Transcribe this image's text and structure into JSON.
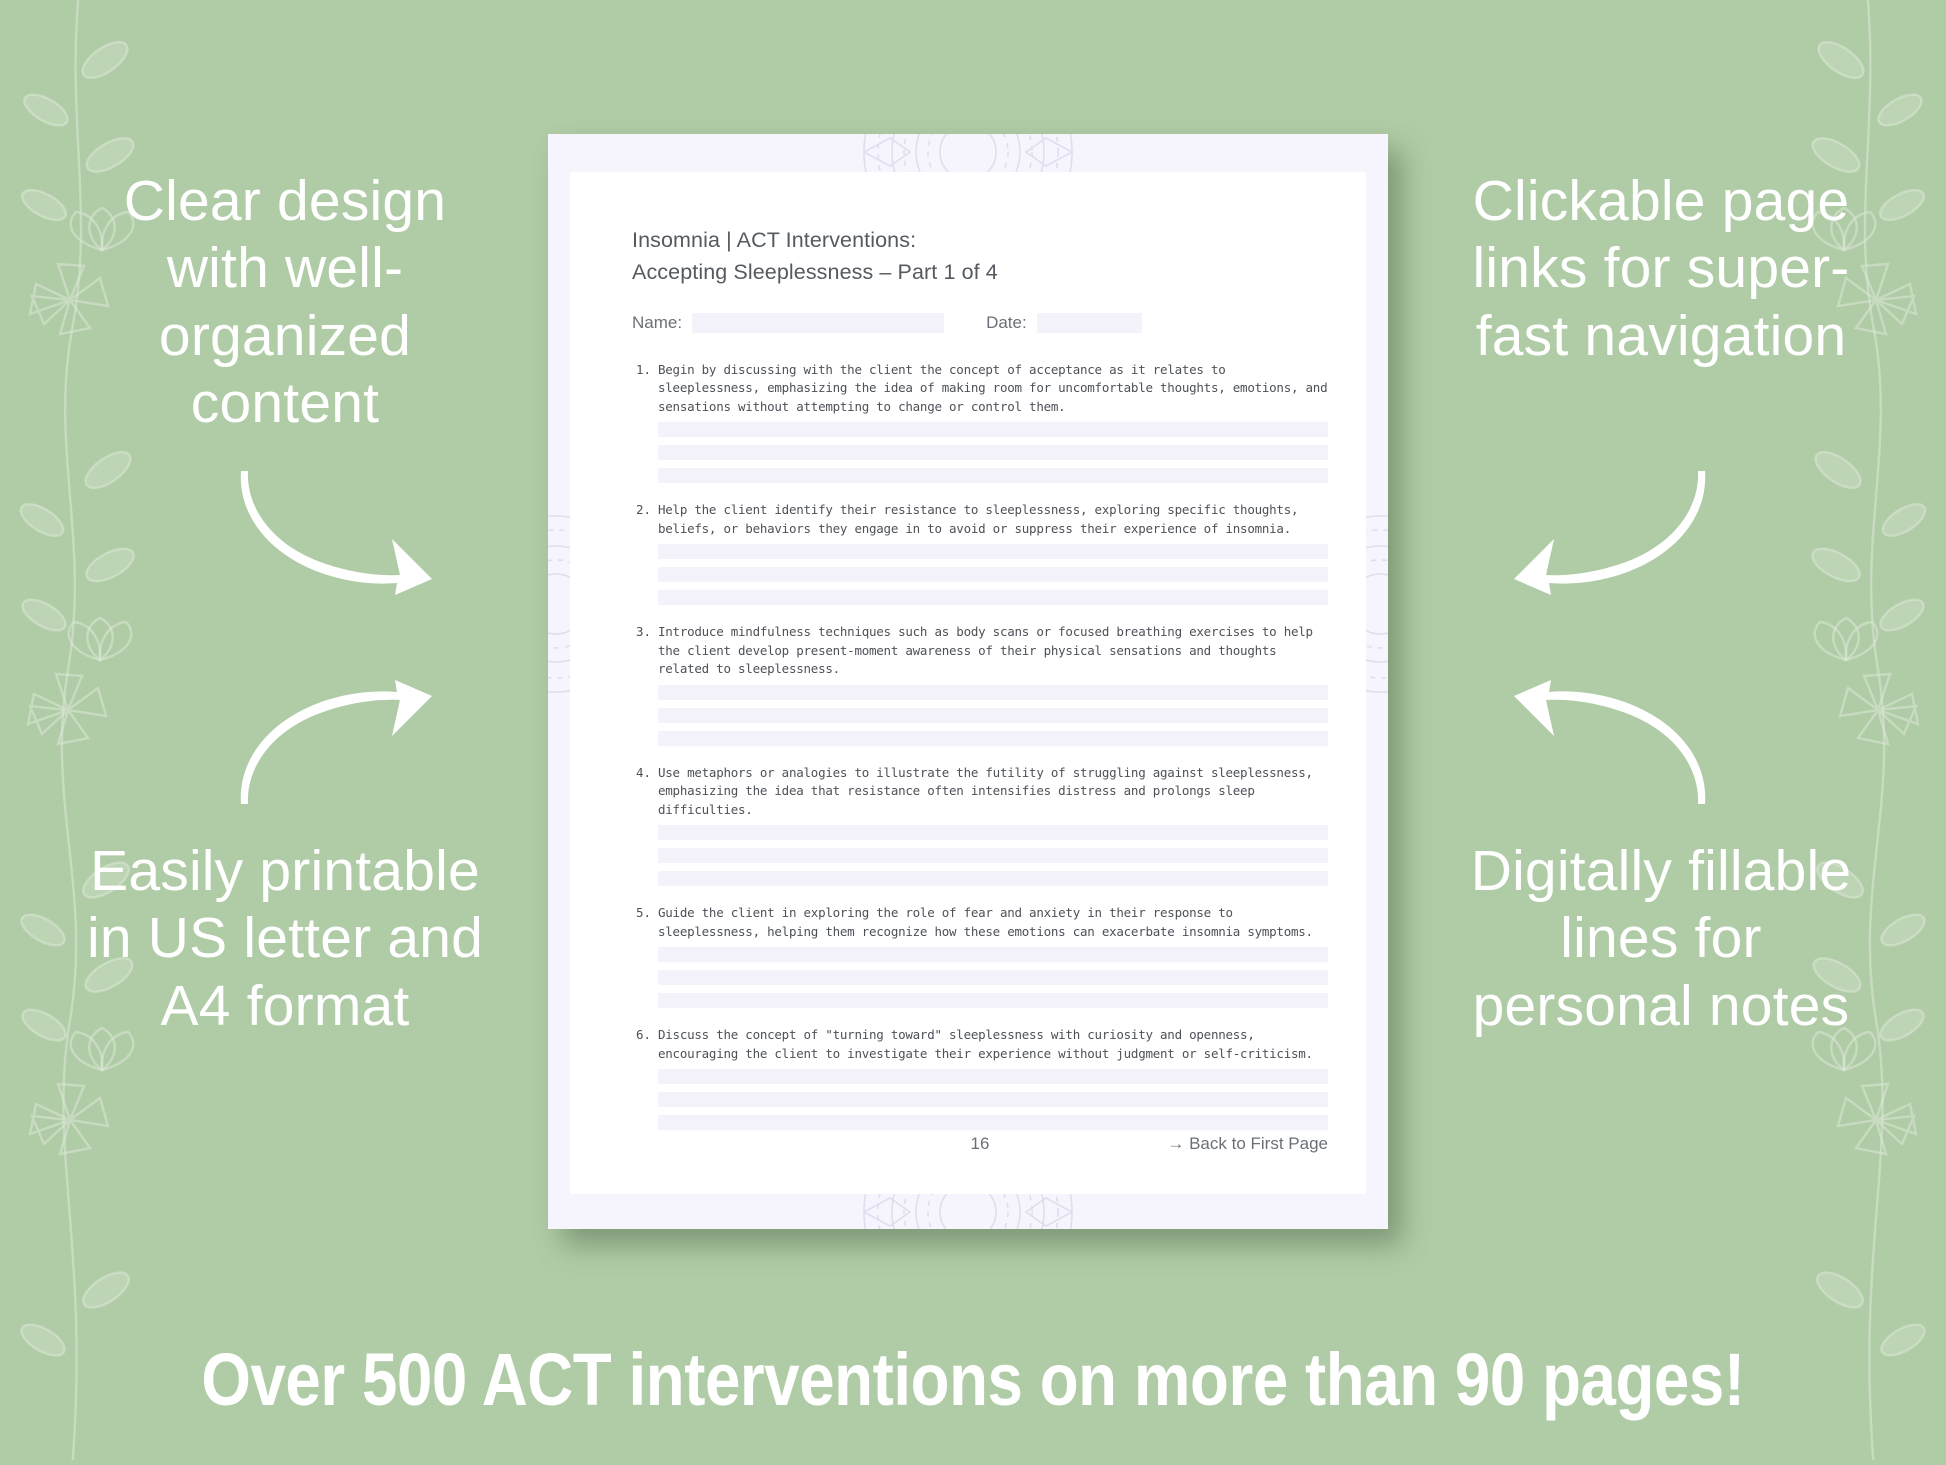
{
  "theme": {
    "background_green": "#b0cca6",
    "promo_text_color": "#ffffff",
    "page_margin_lavender": "#f6f4fc",
    "fill_line_lavender": "#f4f2fb",
    "doc_text_color": "#4d5158"
  },
  "promos": {
    "top_left": "Clear design with well-organized content",
    "bottom_left": "Easily printable in US letter and A4 format",
    "top_right": "Clickable page links for super-fast navigation",
    "bottom_right": "Digitally fillable lines for personal notes"
  },
  "banner": {
    "text": "Over 500 ACT interventions on more than 90 pages!"
  },
  "document": {
    "title_line_1": "Insomnia | ACT Interventions:",
    "title_line_2": "Accepting Sleeplessness – Part 1 of 4",
    "name_label": "Name:",
    "date_label": "Date:",
    "name_value": "",
    "date_value": "",
    "items": [
      {
        "number": "1.",
        "text": "Begin by discussing with the client the concept of acceptance as it relates to sleeplessness, emphasizing the idea of making room for uncomfortable thoughts, emotions, and sensations without attempting to change or control them.",
        "fill_lines": 3
      },
      {
        "number": "2.",
        "text": "Help the client identify their resistance to sleeplessness, exploring specific thoughts, beliefs, or behaviors they engage in to avoid or suppress their experience of insomnia.",
        "fill_lines": 3
      },
      {
        "number": "3.",
        "text": "Introduce mindfulness techniques such as body scans or focused breathing exercises to help the client develop present-moment awareness of their physical sensations and thoughts related to sleeplessness.",
        "fill_lines": 3
      },
      {
        "number": "4.",
        "text": "Use metaphors or analogies to illustrate the futility of struggling against sleeplessness, emphasizing the idea that resistance often intensifies distress and prolongs sleep difficulties.",
        "fill_lines": 3
      },
      {
        "number": "5.",
        "text": "Guide the client in exploring the role of fear and anxiety in their response to sleeplessness, helping them recognize how these emotions can exacerbate insomnia symptoms.",
        "fill_lines": 3
      },
      {
        "number": "6.",
        "text": "Discuss the concept of \"turning toward\" sleeplessness with curiosity and openness, encouraging the client to investigate their experience without judgment or self-criticism.",
        "fill_lines": 3
      }
    ],
    "footer": {
      "page_number": "16",
      "back_link": "→ Back to First Page"
    }
  }
}
